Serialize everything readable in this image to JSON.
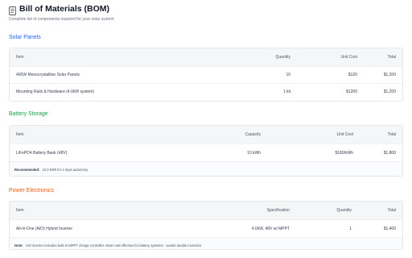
{
  "header": {
    "title": "Bill of Materials (BOM)",
    "subtitle": "Complete list of components required for your solar system"
  },
  "sections": {
    "solar": {
      "title": "Solar Panels",
      "columns": [
        "Item",
        "Quantity",
        "Unit Cost",
        "Total"
      ],
      "rows": [
        [
          "400W Monocrystalline Solar Panels",
          "10",
          "$120",
          "$1,200"
        ],
        [
          "Mounting Rails & Hardware (4.0kW system)",
          "1 kit",
          "$1200",
          "$1,200"
        ]
      ]
    },
    "battery": {
      "title": "Battery Storage",
      "columns": [
        "Item",
        "Capacity",
        "Unit Cost",
        "Total"
      ],
      "rows": [
        [
          "LiFePO4 Battery Bank (48V)",
          "10 kWh",
          "$180/kWh",
          "$1,800"
        ]
      ],
      "note_label": "Recommended:",
      "note_text": "15.0 kWh for 2 days autonomy"
    },
    "power": {
      "title": "Power Electronics",
      "columns": [
        "Item",
        "Specification",
        "Quantity",
        "Total"
      ],
      "rows": [
        [
          "All-In-One (AIO) Hybrid Inverter",
          "4.0kW, 48V w/ MPPT",
          "1",
          "$1,400"
        ]
      ],
      "note_label": "Note:",
      "note_text": "AIO inverter includes built-in MPPT charge controller. Most cost-effective for battery systems - avoids double inversion."
    }
  },
  "colors": {
    "solar_accent": "#2563eb",
    "battery_accent": "#16a34a",
    "power_accent": "#ea580c"
  },
  "icons": {
    "title_icon": "document-icon"
  }
}
